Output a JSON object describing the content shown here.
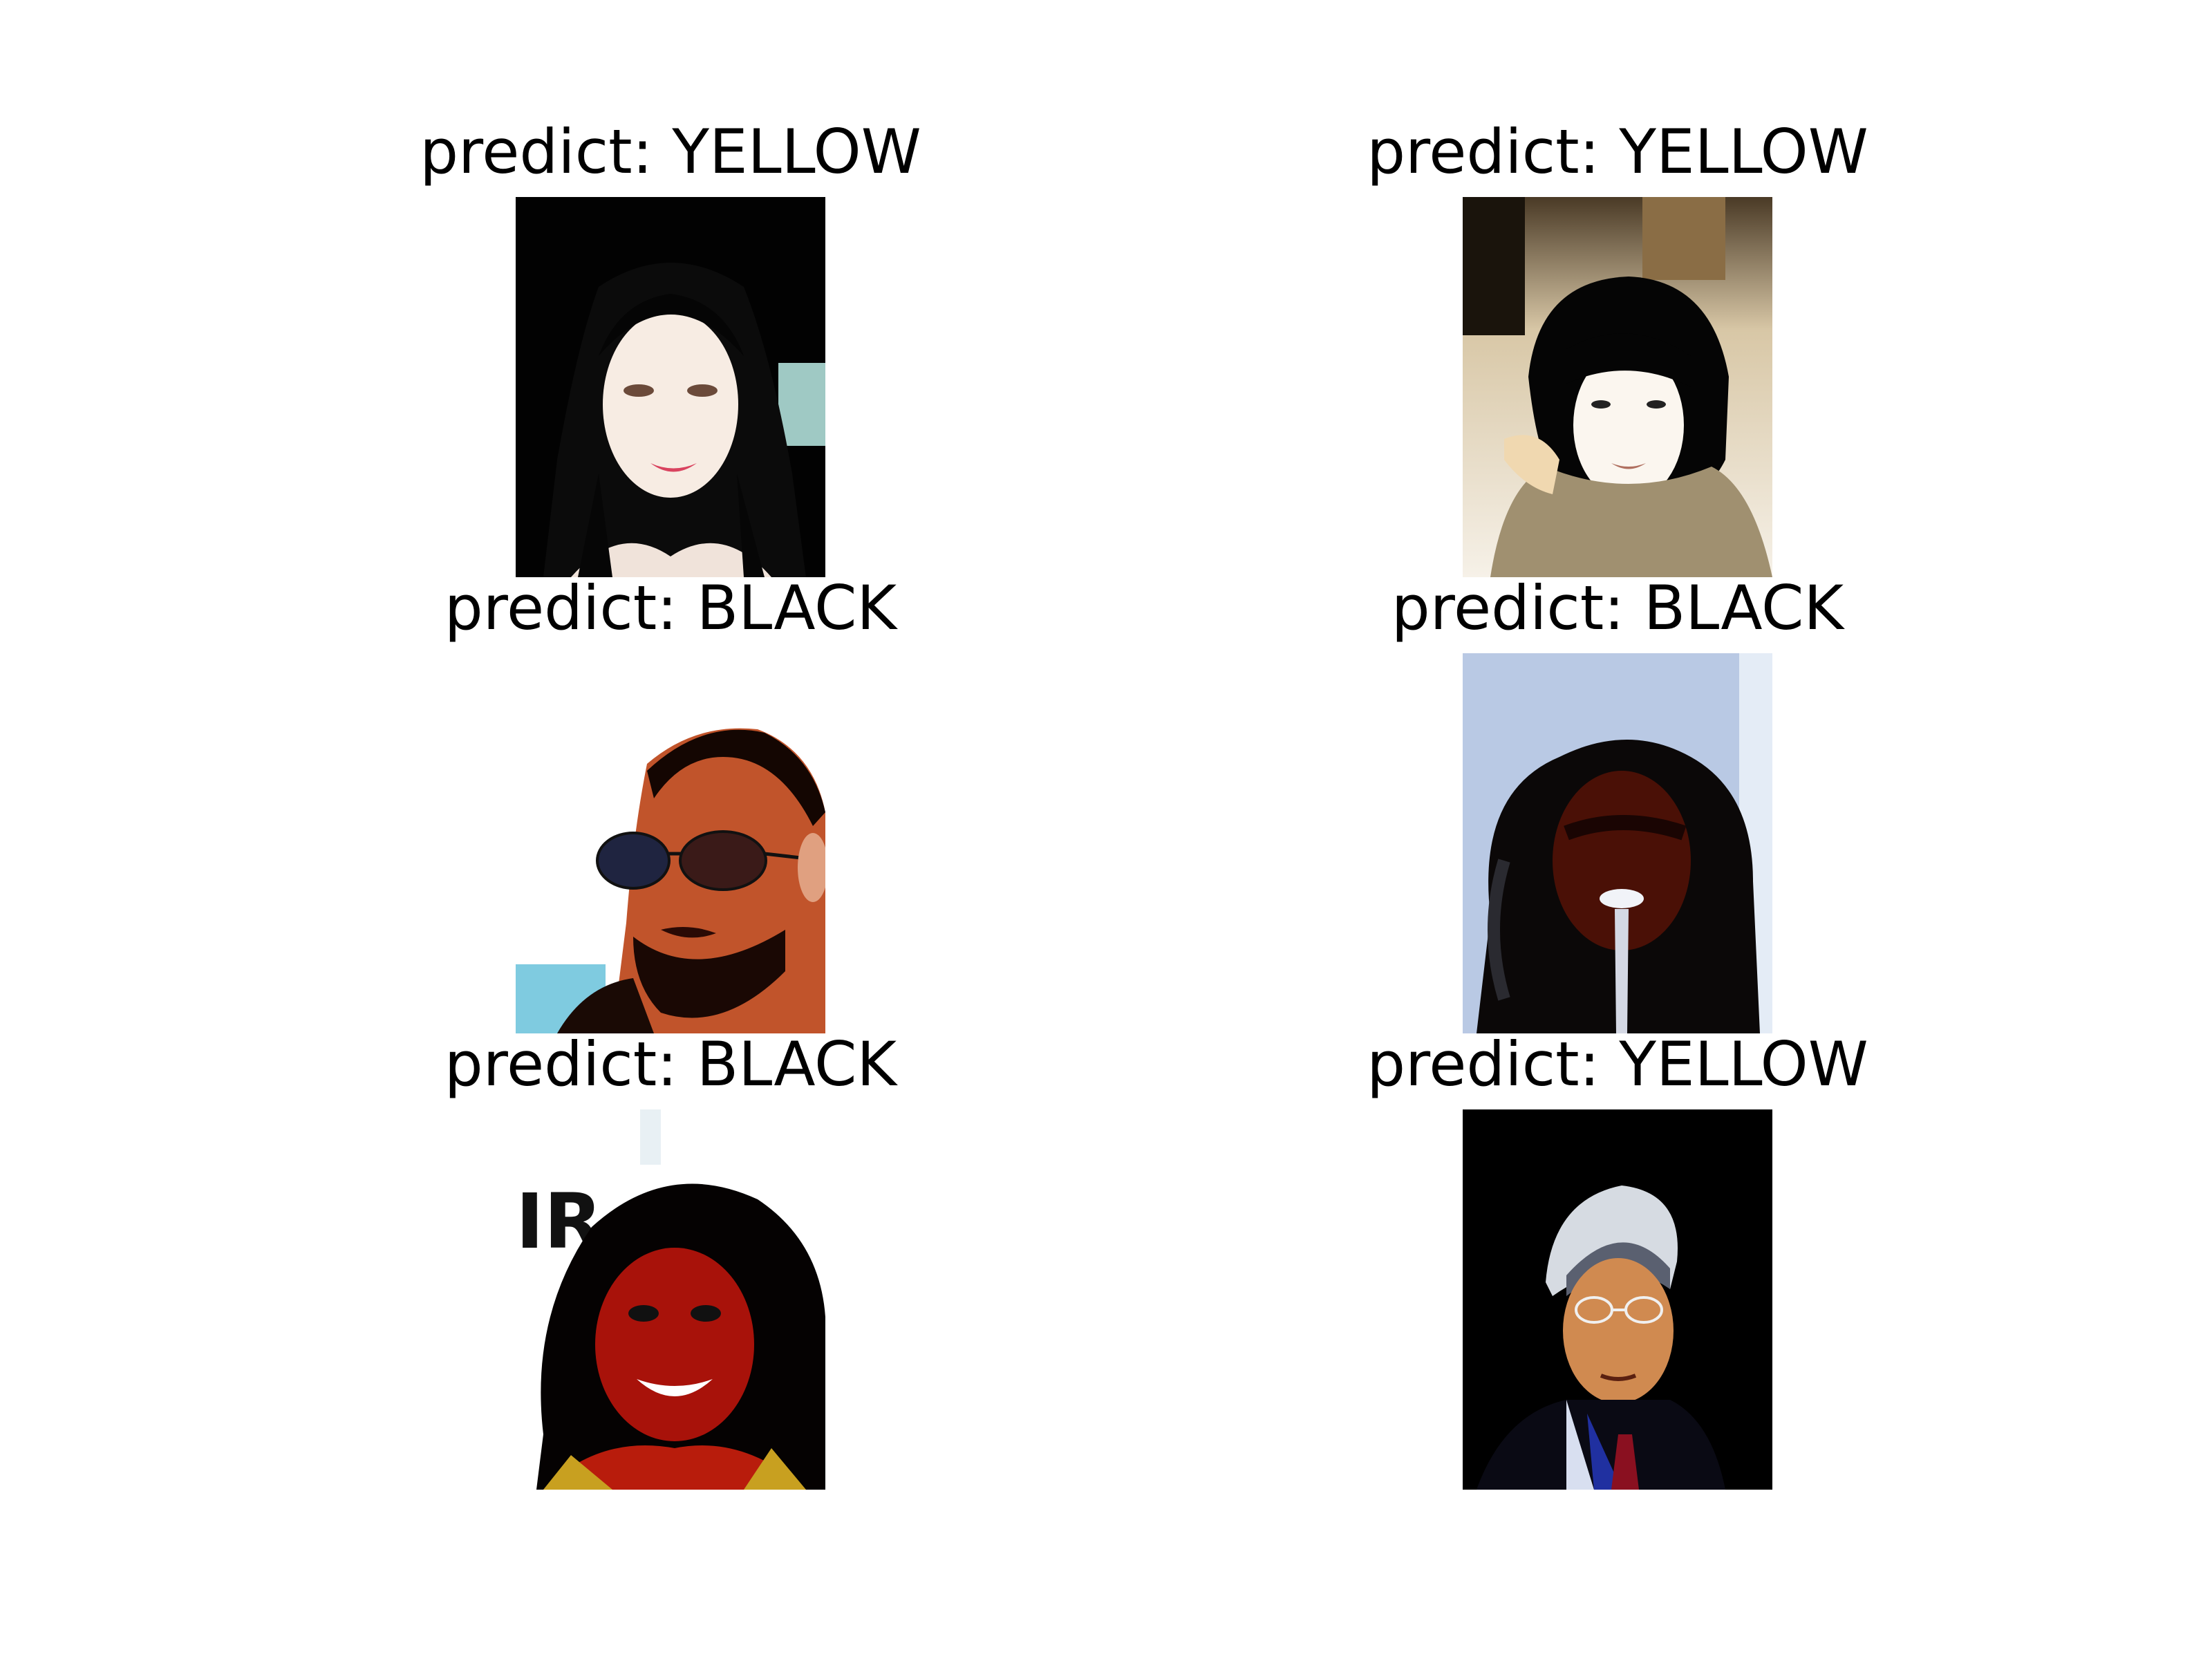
{
  "panels": [
    {
      "title": "predict: YELLOW"
    },
    {
      "title": "predict: YELLOW"
    },
    {
      "title": "predict: BLACK"
    },
    {
      "title": "predict: BLACK"
    },
    {
      "title": "predict: BLACK"
    },
    {
      "title": "predict: YELLOW"
    }
  ],
  "photo_logo_text": "IR",
  "colors": {
    "background": "#ffffff",
    "text": "#000000"
  }
}
